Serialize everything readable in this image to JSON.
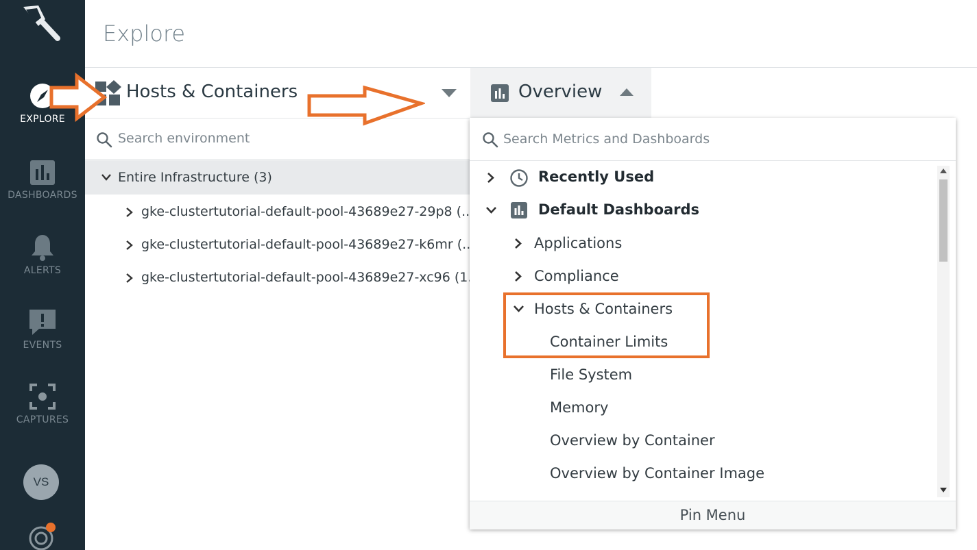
{
  "page": {
    "title": "Explore"
  },
  "sidebar": {
    "items": [
      {
        "label": "EXPLORE",
        "icon": "compass-icon",
        "active": true
      },
      {
        "label": "DASHBOARDS",
        "icon": "bar-chart-icon",
        "active": false
      },
      {
        "label": "ALERTS",
        "icon": "bell-icon",
        "active": false
      },
      {
        "label": "EVENTS",
        "icon": "exclamation-message-icon",
        "active": false
      },
      {
        "label": "CAPTURES",
        "icon": "capture-icon",
        "active": false
      }
    ],
    "avatar_initials": "VS"
  },
  "scope": {
    "title": "Hosts & Containers",
    "search_placeholder": "Search environment",
    "tree": {
      "root": "Entire Infrastructure (3)",
      "children": [
        "gke-clustertutorial-default-pool-43689e27-29p8 (...",
        "gke-clustertutorial-default-pool-43689e27-k6mr (...",
        "gke-clustertutorial-default-pool-43689e27-xc96 (1..."
      ]
    }
  },
  "overview": {
    "title": "Overview",
    "search_placeholder": "Search Metrics and Dashboards",
    "menu": {
      "recently_used": "Recently Used",
      "default_dashboards": "Default Dashboards",
      "applications": "Applications",
      "compliance": "Compliance",
      "hosts_containers": "Hosts & Containers",
      "items": [
        "Container Limits",
        "File System",
        "Memory",
        "Overview by Container",
        "Overview by Container Image"
      ]
    },
    "pin_menu": "Pin Menu"
  },
  "colors": {
    "sidebar_bg": "#1c2c36",
    "annotation": "#e8712c",
    "selected_row": "#e8eaec"
  }
}
